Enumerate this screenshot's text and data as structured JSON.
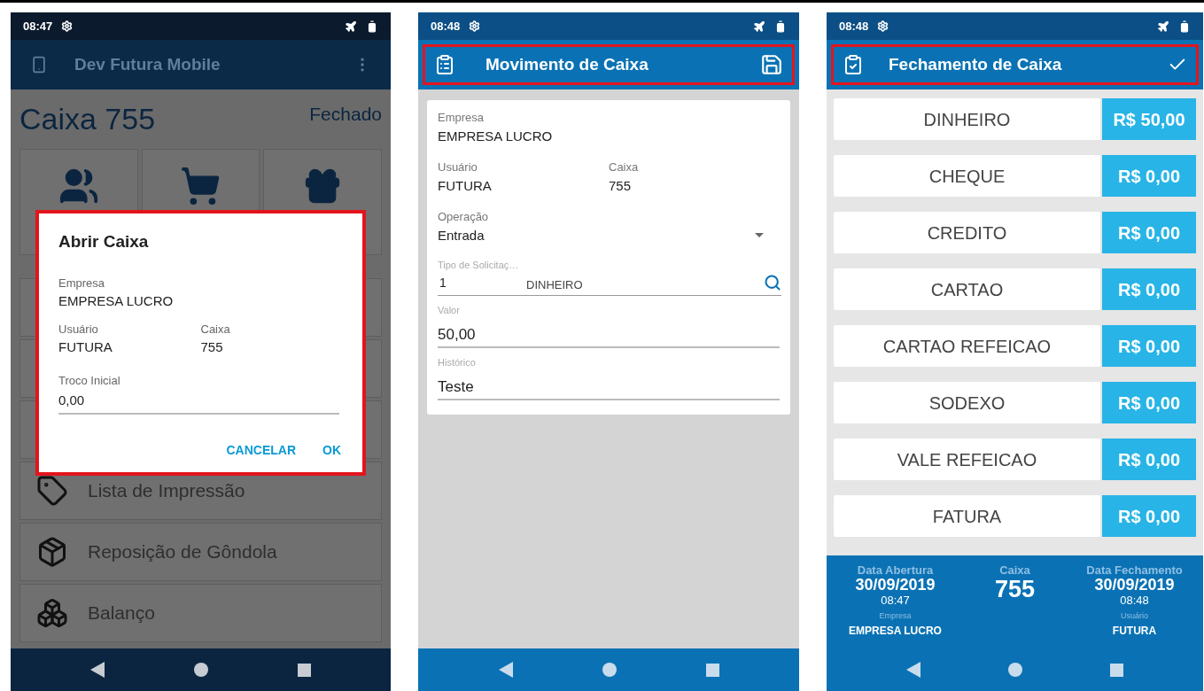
{
  "open_cash_screen": {
    "status_time": "08:47",
    "app_title": "Dev Futura Mobile",
    "heading": "Caixa 755",
    "status": "Fechado",
    "tiles": [
      {
        "kind": "people"
      },
      {
        "kind": "cart"
      },
      {
        "kind": "gift"
      }
    ],
    "menu_items": [
      {
        "label": "Lista de Impressão",
        "kind": "tag"
      },
      {
        "label": "Reposição de Gôndola",
        "kind": "box"
      },
      {
        "label": "Balanço",
        "kind": "boxes"
      }
    ],
    "dialog": {
      "title": "Abrir Caixa",
      "company": {
        "label": "Empresa",
        "value": "EMPRESA LUCRO"
      },
      "user": {
        "label": "Usuário",
        "value": "FUTURA"
      },
      "register": {
        "label": "Caixa",
        "value": "755"
      },
      "input": {
        "label": "Troco Inicial",
        "value": "0,00"
      },
      "buttons": [
        "CANCELAR",
        "OK"
      ]
    }
  },
  "movement_screen": {
    "status_time": "08:48",
    "title": "Movimento de Caixa",
    "company": {
      "label": "Empresa",
      "value": "EMPRESA LUCRO"
    },
    "user": {
      "label": "Usuário",
      "value": "FUTURA"
    },
    "register": {
      "label": "Caixa",
      "value": "755"
    },
    "operation": {
      "label": "Operação",
      "value": "Entrada"
    },
    "request_type": {
      "label": "Tipo de Solicitaç…",
      "code": "1",
      "description": "DINHEIRO"
    },
    "amount": {
      "label": "Valor",
      "value": "50,00"
    },
    "history": {
      "label": "Histórico",
      "value": "Teste"
    }
  },
  "closing_screen": {
    "status_time": "08:48",
    "title": "Fechamento de Caixa",
    "rows": [
      {
        "label": "DINHEIRO",
        "amount": "R$ 50,00"
      },
      {
        "label": "CHEQUE",
        "amount": "R$ 0,00"
      },
      {
        "label": "CREDITO",
        "amount": "R$ 0,00"
      },
      {
        "label": "CARTAO",
        "amount": "R$ 0,00"
      },
      {
        "label": "CARTAO REFEICAO",
        "amount": "R$ 0,00"
      },
      {
        "label": "SODEXO",
        "amount": "R$ 0,00"
      },
      {
        "label": "VALE REFEICAO",
        "amount": "R$ 0,00"
      },
      {
        "label": "FATURA",
        "amount": "R$ 0,00"
      }
    ],
    "footer": {
      "opening": {
        "label": "Data Abertura",
        "date": "30/09/2019",
        "time": "08:47"
      },
      "register": {
        "label": "Caixa",
        "value": "755"
      },
      "closing": {
        "label": "Data Fechamento",
        "date": "30/09/2019",
        "time": "08:48"
      },
      "company": {
        "label": "Empresa",
        "value": "EMPRESA LUCRO"
      },
      "user": {
        "label": "Usuário",
        "value": "FUTURA"
      }
    }
  }
}
